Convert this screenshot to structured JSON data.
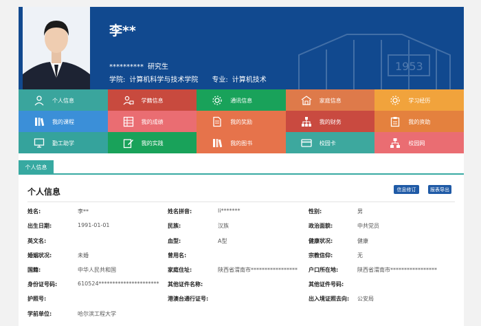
{
  "header": {
    "name": "李**",
    "student_id": "**********",
    "degree": "研究生",
    "college_label": "学院:",
    "college": "计算机科学与技术学院",
    "major_label": "专业:",
    "major": "计算机技术",
    "building_year": "1953",
    "colors": {
      "banner": "#11498f"
    }
  },
  "tiles": [
    {
      "label": "个人信息",
      "icon": "user-icon",
      "color": "#3aa59d"
    },
    {
      "label": "学籍信息",
      "icon": "user-card-icon",
      "color": "#c84a3e"
    },
    {
      "label": "通讯信息",
      "icon": "gear-icon",
      "color": "#19a25a"
    },
    {
      "label": "家庭信息",
      "icon": "home-icon",
      "color": "#de7a4a"
    },
    {
      "label": "学习经历",
      "icon": "gear-icon",
      "color": "#f1a33c"
    },
    {
      "label": "我的课程",
      "icon": "books-icon",
      "color": "#3b8fd8"
    },
    {
      "label": "我的成绩",
      "icon": "grid-icon",
      "color": "#ea6d72"
    },
    {
      "label": "我的奖励",
      "icon": "document-icon",
      "color": "#e6734b"
    },
    {
      "label": "我的财务",
      "icon": "org-icon",
      "color": "#c94a40"
    },
    {
      "label": "我的资助",
      "icon": "clipboard-icon",
      "color": "#e4813e"
    },
    {
      "label": "勤工助学",
      "icon": "monitor-icon",
      "color": "#35a39c"
    },
    {
      "label": "我的实践",
      "icon": "edit-icon",
      "color": "#19a25a"
    },
    {
      "label": "我的图书",
      "icon": "books-icon",
      "color": "#e6734b"
    },
    {
      "label": "校园卡",
      "icon": "card-icon",
      "color": "#3da89e"
    },
    {
      "label": "校园网",
      "icon": "network-icon",
      "color": "#ea6d72"
    }
  ],
  "tab": {
    "label": "个人信息",
    "color": "#37a9a1"
  },
  "panel": {
    "title": "个人信息",
    "edit_button": "信息修订",
    "export_button": "报表导出",
    "rows": [
      [
        [
          "姓名:",
          "李**"
        ],
        [
          "姓名拼音:",
          "li*******"
        ],
        [
          "性别:",
          "男"
        ]
      ],
      [
        [
          "出生日期:",
          "1991-01-01"
        ],
        [
          "民族:",
          "汉族"
        ],
        [
          "政治面貌:",
          "中共党员"
        ]
      ],
      [
        [
          "英文名:",
          ""
        ],
        [
          "血型:",
          "A型"
        ],
        [
          "健康状况:",
          "健康"
        ]
      ],
      [
        [
          "婚姻状况:",
          "未婚"
        ],
        [
          "曾用名:",
          ""
        ],
        [
          "宗教信仰:",
          "无"
        ]
      ],
      [
        [
          "国籍:",
          "中华人民共和国"
        ],
        [
          "家庭住址:",
          "陕西省渭南市*****************"
        ],
        [
          "户口所在地:",
          "陕西省渭南市*****************"
        ]
      ],
      [
        [
          "身份证号码:",
          "610524**********************"
        ],
        [
          "其他证件名称:",
          ""
        ],
        [
          "其他证件号码:",
          ""
        ]
      ],
      [
        [
          "护照号:",
          ""
        ],
        [
          "港澳台通行证号:",
          ""
        ],
        [
          "出入境证照去向:",
          "公安局"
        ]
      ],
      [
        [
          "学前单位:",
          "哈尔滨工程大学"
        ],
        [
          "",
          ""
        ],
        [
          "",
          ""
        ]
      ]
    ]
  }
}
